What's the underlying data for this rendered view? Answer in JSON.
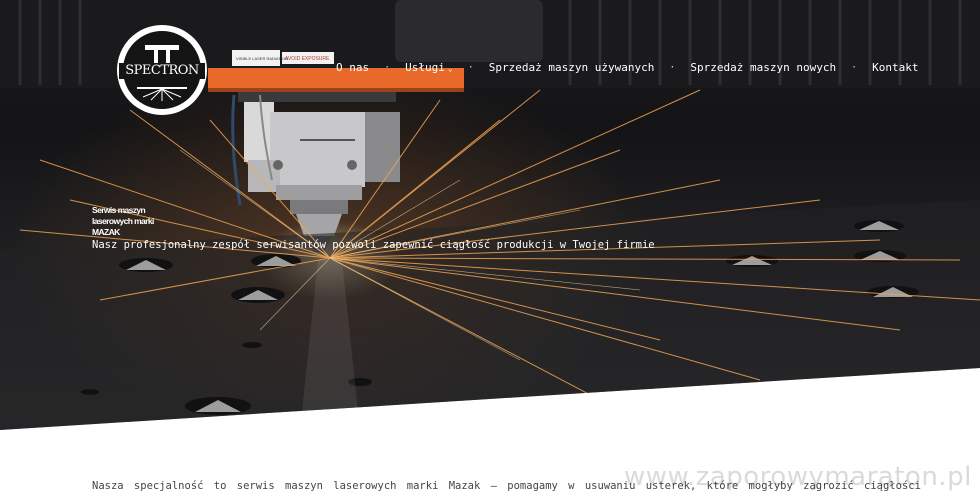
{
  "brand": {
    "name": "SPECTRON"
  },
  "nav": {
    "items": [
      {
        "label": "O nas"
      },
      {
        "label": "Usługi",
        "dropdown": true
      },
      {
        "label": "Sprzedaż maszyn używanych"
      },
      {
        "label": "Sprzedaż maszyn nowych"
      },
      {
        "label": "Kontakt"
      }
    ],
    "separator": "·",
    "dropdown_icon": "chevron-down-icon"
  },
  "hero": {
    "title": "Serwis maszyn laserowych marki MAZAK",
    "subtitle": "Nasz profesjonalny zespół serwisantów pozwoli zapewnić ciągłość produkcji w Twojej firmie",
    "machine_label_1": "AVOID EXPOSURE",
    "machine_label_2": "VISIBLE LASER RADIATION"
  },
  "content": {
    "intro": "Nasza specjalność to serwis maszyn laserowych marki Mazak – pomagamy w usuwaniu usterek, które mogłyby zagrozić ciągłości"
  },
  "watermark": "www.zaporowymaraton.pl",
  "colors": {
    "accent": "#e8692a",
    "spark": "#f0a552",
    "text": "#444444"
  }
}
